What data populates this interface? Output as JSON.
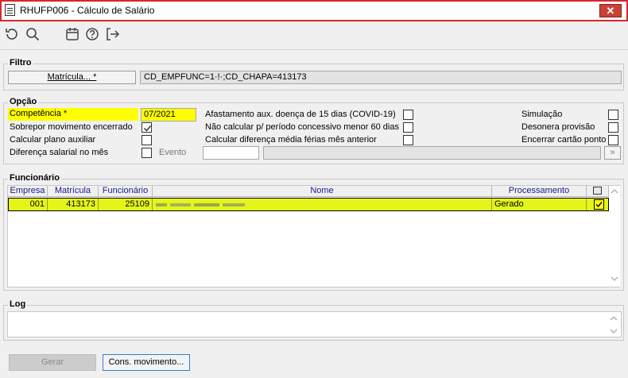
{
  "window": {
    "title": "RHUFP006 - Cálculo de Salário",
    "close_icon": "close-icon"
  },
  "toolbar": {
    "icons": [
      "refresh-icon",
      "search-icon",
      "calendar-icon",
      "help-icon",
      "exit-icon"
    ]
  },
  "filtro": {
    "group_label": "Filtro",
    "matricula_button": "Matrícula... *",
    "filter_value": "CD_EMPFUNC=1·!·;CD_CHAPA=413173"
  },
  "opcao": {
    "group_label": "Opção",
    "competencia_label": "Competência *",
    "competencia_value": "07/2021",
    "sobrepor_label": "Sobrepor movimento encerrado",
    "sobrepor_checked": true,
    "calc_plano_label": "Calcular plano auxiliar",
    "diferenca_label": "Diferença salarial no mês",
    "evento_label": "Evento",
    "afastamento_label": "Afastamento aux. doença de 15 dias (COVID-19)",
    "nao_calcular_label": "Não calcular p/ período concessivo menor 60 dias",
    "calc_diferenca_label": "Calcular diferença média férias mês anterior",
    "simulacao_label": "Simulação",
    "desonera_label": "Desonera provisão",
    "encerrar_label": "Encerrar cartão ponto"
  },
  "funcionario": {
    "group_label": "Funcionário",
    "columns": [
      "Empresa",
      "Matrícula",
      "Funcionário",
      "Nome",
      "Processamento"
    ],
    "rows": [
      {
        "empresa": "001",
        "matricula": "413173",
        "funcionario": "25109",
        "nome": "",
        "processamento": "Gerado",
        "checked": true
      }
    ]
  },
  "log": {
    "group_label": "Log"
  },
  "footer": {
    "gerar_label": "Gerar",
    "cons_label": "Cons. movimento..."
  },
  "colors": {
    "highlight": "#ffff00",
    "row_selected": "#e5f51a",
    "title_border": "#d9262b",
    "close_button": "#c94236"
  }
}
